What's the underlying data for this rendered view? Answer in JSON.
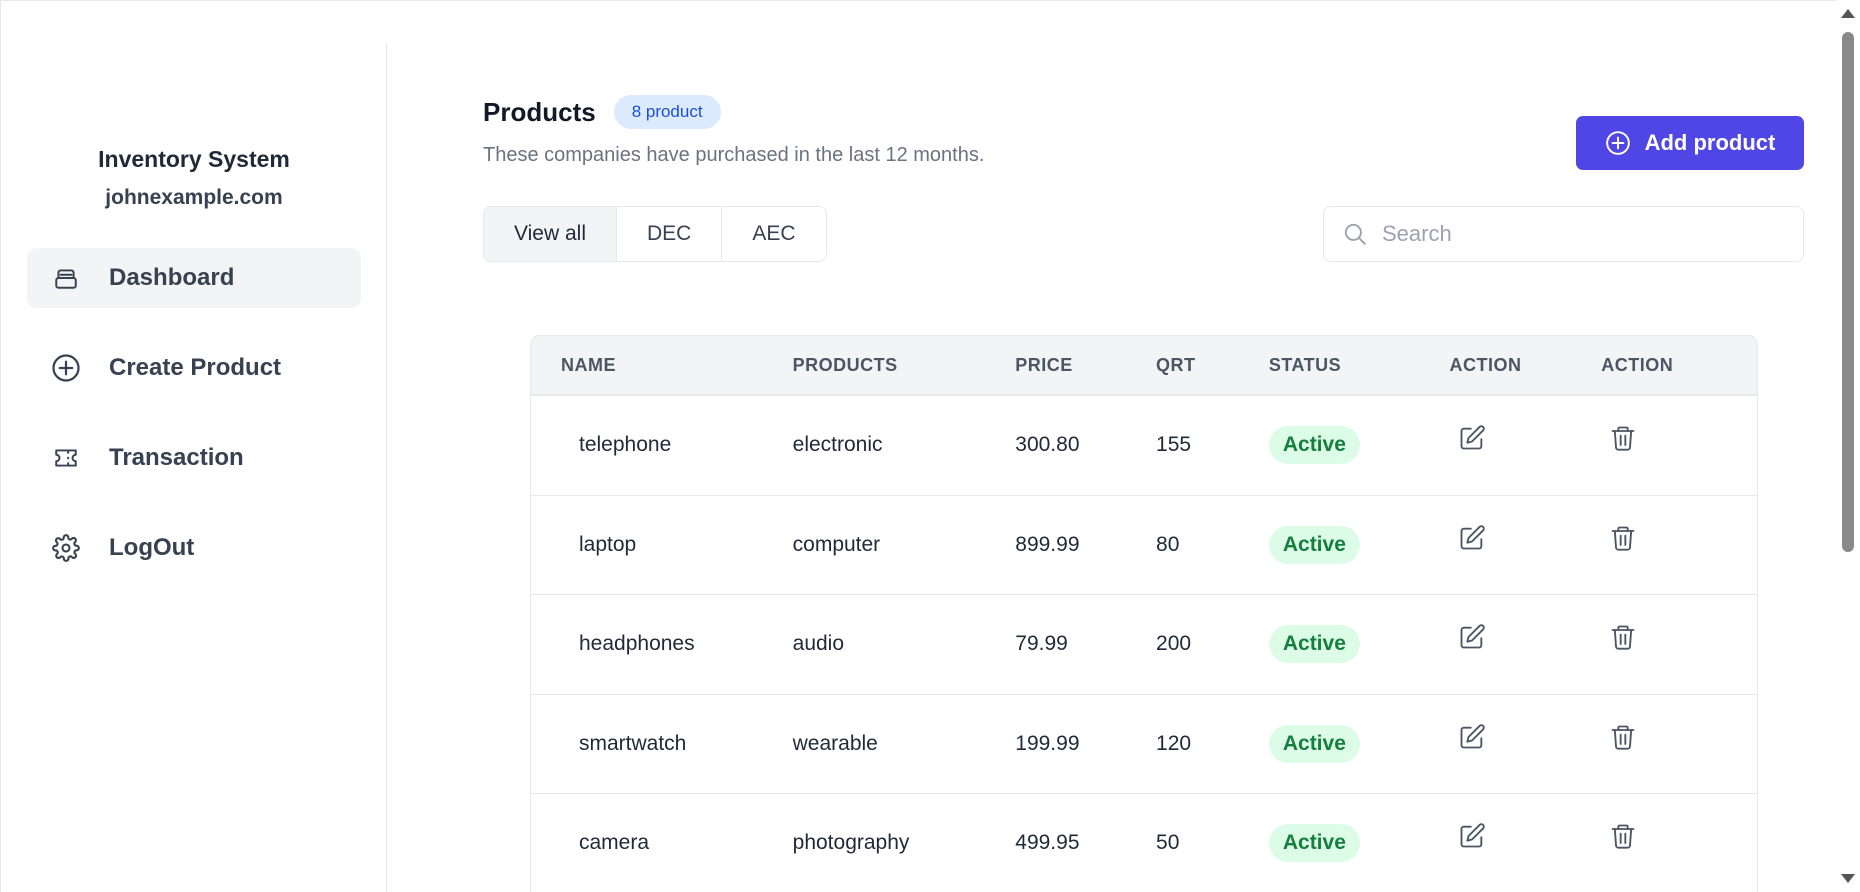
{
  "app": {
    "title": "Inventory System",
    "email": "johnexample.com"
  },
  "sidebar": {
    "items": [
      {
        "label": "Dashboard",
        "icon": "drawer-icon",
        "active": true
      },
      {
        "label": "Create Product",
        "icon": "plus-circle-icon",
        "active": false
      },
      {
        "label": "Transaction",
        "icon": "ticket-icon",
        "active": false
      },
      {
        "label": "LogOut",
        "icon": "gear-icon",
        "active": false
      }
    ]
  },
  "header": {
    "title": "Products",
    "count_badge": "8 product",
    "subtitle": "These companies have purchased in the last 12 months.",
    "add_button": "Add product"
  },
  "filters": {
    "options": [
      "View all",
      "DEC",
      "AEC"
    ],
    "selected": "View all"
  },
  "search": {
    "placeholder": "Search",
    "value": ""
  },
  "table": {
    "columns": [
      "NAME",
      "PRODUCTS",
      "PRICE",
      "QRT",
      "STATUS",
      "ACTION",
      "ACTION"
    ],
    "rows": [
      {
        "name": "telephone",
        "product": "electronic",
        "price": "300.80",
        "qty": "155",
        "status": "Active"
      },
      {
        "name": "laptop",
        "product": "computer",
        "price": "899.99",
        "qty": "80",
        "status": "Active"
      },
      {
        "name": "headphones",
        "product": "audio",
        "price": "79.99",
        "qty": "200",
        "status": "Active"
      },
      {
        "name": "smartwatch",
        "product": "wearable",
        "price": "199.99",
        "qty": "120",
        "status": "Active"
      },
      {
        "name": "camera",
        "product": "photography",
        "price": "499.95",
        "qty": "50",
        "status": "Active"
      }
    ]
  },
  "colors": {
    "accent": "#4f46e5",
    "status_active_bg": "#dcfce7",
    "status_active_text": "#15803d",
    "badge_bg": "#dbeafe",
    "badge_text": "#1d4ed8"
  }
}
